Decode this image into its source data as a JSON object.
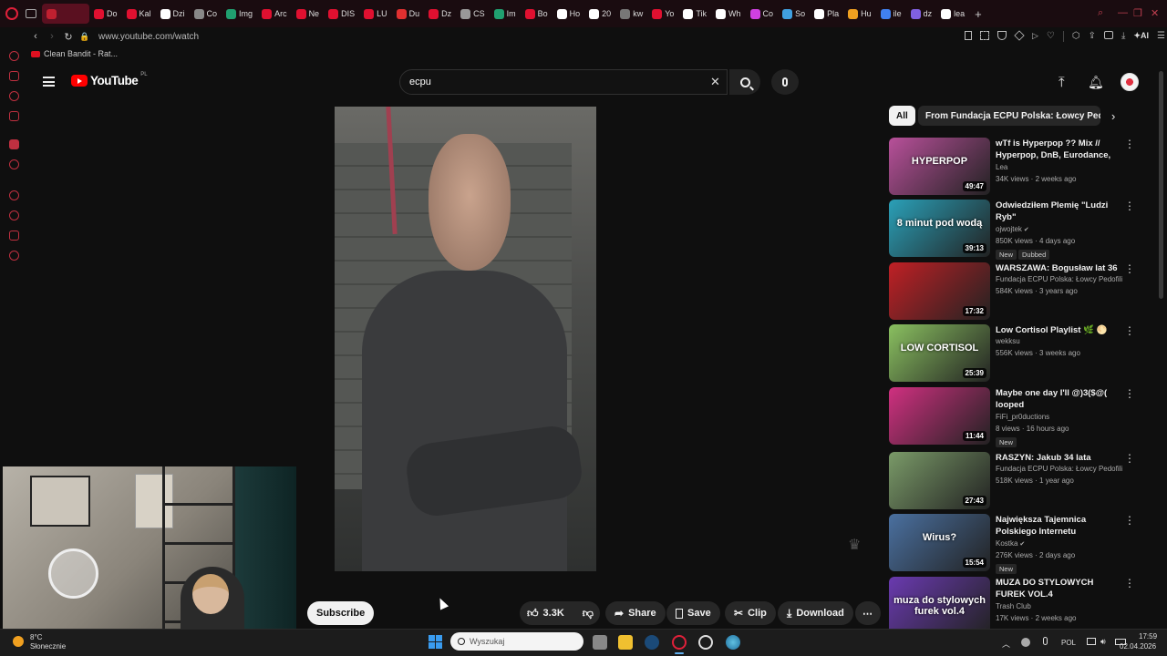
{
  "browser": {
    "tabs": [
      {
        "label": "",
        "color": "#c02030"
      },
      {
        "label": "Do",
        "color": "#e01030"
      },
      {
        "label": "Kal",
        "color": "#e01030"
      },
      {
        "label": "Dzi",
        "color": "#ffffff"
      },
      {
        "label": "Co",
        "color": "#888888"
      },
      {
        "label": "Img",
        "color": "#20a070"
      },
      {
        "label": "Arc",
        "color": "#e01030"
      },
      {
        "label": "Ne",
        "color": "#e01030"
      },
      {
        "label": "DIS",
        "color": "#e01030"
      },
      {
        "label": "LU",
        "color": "#e01030"
      },
      {
        "label": "Du",
        "color": "#e03030"
      },
      {
        "label": "Dz",
        "color": "#e01030"
      },
      {
        "label": "CS",
        "color": "#999999"
      },
      {
        "label": "Im",
        "color": "#20a070"
      },
      {
        "label": "Bo",
        "color": "#e01030"
      },
      {
        "label": "Ho",
        "color": "#ffffff"
      },
      {
        "label": "20",
        "color": "#ffffff"
      },
      {
        "label": "kw",
        "color": "#777777"
      },
      {
        "label": "Yo",
        "color": "#e01030"
      },
      {
        "label": "Tik",
        "color": "#ffffff"
      },
      {
        "label": "Wh",
        "color": "#ffffff"
      },
      {
        "label": "Co",
        "color": "#d040e0"
      },
      {
        "label": "So",
        "color": "#40a0e0"
      },
      {
        "label": "Pla",
        "color": "#ffffff"
      },
      {
        "label": "Hu",
        "color": "#f0a020"
      },
      {
        "label": "ile",
        "color": "#4080f0"
      },
      {
        "label": "dz",
        "color": "#8060e0"
      },
      {
        "label": "lea",
        "color": "#ffffff"
      }
    ],
    "new_tab": "+",
    "url": "www.youtube.com/watch",
    "bookmark": "Clean Bandit - Rat...",
    "toolbar_ai": "AI"
  },
  "youtube": {
    "logo": "YouTube",
    "region": "PL",
    "search_value": "ecpu",
    "clear": "✕"
  },
  "actions": {
    "subscribe": "Subscribe",
    "likes": "3.3K",
    "share": "Share",
    "save": "Save",
    "clip": "Clip",
    "download": "Download",
    "more": "⋯"
  },
  "chips": {
    "all": "All",
    "from_channel": "From Fundacja ECPU Polska: Łowcy Pedofili"
  },
  "recommendations": [
    {
      "title": "wTf is Hyperpop ?? Mix // Hyperpop, DnB, Eurodance, J-...",
      "channel": "Lea",
      "meta": "34K views · 2 weeks ago",
      "duration": "49:47",
      "thumb_color": "#b8509a",
      "thumb_text": "HYPERPOP",
      "verified": false,
      "badges": []
    },
    {
      "title": "Odwiedziłem Plemię \"Ludzi Ryb\"",
      "channel": "ojwojtek",
      "meta": "850K views · 4 days ago",
      "duration": "39:13",
      "thumb_color": "#2aa0b8",
      "thumb_text": "8 minut pod wodą",
      "verified": true,
      "badges": [
        "New",
        "Dubbed"
      ]
    },
    {
      "title": "WARSZAWA: Bogusław lat 36",
      "channel": "Fundacja ECPU Polska: Łowcy Pedofili",
      "meta": "584K views · 3 years ago",
      "duration": "17:32",
      "thumb_color": "#c02025",
      "thumb_text": "",
      "verified": false,
      "badges": []
    },
    {
      "title": "Low Cortisol Playlist 🌿 🌕",
      "channel": "wekksu",
      "meta": "556K views · 3 weeks ago",
      "duration": "25:39",
      "thumb_color": "#8ac060",
      "thumb_text": "LOW CORTISOL",
      "verified": false,
      "badges": []
    },
    {
      "title": "Maybe one day I'll @)3($@( looped",
      "channel": "FiFi_pr0ductions",
      "meta": "8 views · 16 hours ago",
      "duration": "11:44",
      "thumb_color": "#d03080",
      "thumb_text": "",
      "verified": false,
      "badges": [
        "New"
      ]
    },
    {
      "title": "RASZYN: Jakub 34 lata",
      "channel": "Fundacja ECPU Polska: Łowcy Pedofili",
      "meta": "518K views · 1 year ago",
      "duration": "27:43",
      "thumb_color": "#7a9a68",
      "thumb_text": "",
      "verified": false,
      "badges": []
    },
    {
      "title": "Największa Tajemnica Polskiego Internetu",
      "channel": "Kostka",
      "meta": "276K views · 2 days ago",
      "duration": "15:54",
      "thumb_color": "#4a70a0",
      "thumb_text": "Wirus?",
      "verified": true,
      "badges": [
        "New"
      ]
    },
    {
      "title": "MUZA DO STYLOWYCH FUREK VOL.4",
      "channel": "Trash Club",
      "meta": "17K views · 2 weeks ago",
      "duration": "",
      "thumb_color": "#6a3ab0",
      "thumb_text": "muza do stylowych furek vol.4",
      "verified": false,
      "badges": []
    }
  ],
  "taskbar": {
    "weather_temp": "8°C",
    "weather_desc": "Słonecznie",
    "search_placeholder": "Wyszukaj",
    "language": "POL",
    "time": "17:59",
    "date": "02.04.2026"
  }
}
